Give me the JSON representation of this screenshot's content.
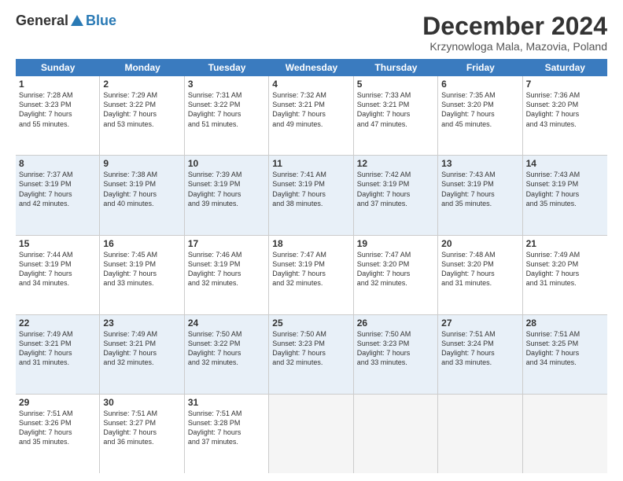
{
  "logo": {
    "general": "General",
    "blue": "Blue"
  },
  "title": "December 2024",
  "subtitle": "Krzynowloga Mala, Mazovia, Poland",
  "days": [
    "Sunday",
    "Monday",
    "Tuesday",
    "Wednesday",
    "Thursday",
    "Friday",
    "Saturday"
  ],
  "rows": [
    [
      {
        "day": "1",
        "sunrise": "7:28 AM",
        "sunset": "3:23 PM",
        "daylight": "7 hours and 55 minutes."
      },
      {
        "day": "2",
        "sunrise": "7:29 AM",
        "sunset": "3:22 PM",
        "daylight": "7 hours and 53 minutes."
      },
      {
        "day": "3",
        "sunrise": "7:31 AM",
        "sunset": "3:22 PM",
        "daylight": "7 hours and 51 minutes."
      },
      {
        "day": "4",
        "sunrise": "7:32 AM",
        "sunset": "3:21 PM",
        "daylight": "7 hours and 49 minutes."
      },
      {
        "day": "5",
        "sunrise": "7:33 AM",
        "sunset": "3:21 PM",
        "daylight": "7 hours and 47 minutes."
      },
      {
        "day": "6",
        "sunrise": "7:35 AM",
        "sunset": "3:20 PM",
        "daylight": "7 hours and 45 minutes."
      },
      {
        "day": "7",
        "sunrise": "7:36 AM",
        "sunset": "3:20 PM",
        "daylight": "7 hours and 43 minutes."
      }
    ],
    [
      {
        "day": "8",
        "sunrise": "7:37 AM",
        "sunset": "3:19 PM",
        "daylight": "7 hours and 42 minutes."
      },
      {
        "day": "9",
        "sunrise": "7:38 AM",
        "sunset": "3:19 PM",
        "daylight": "7 hours and 40 minutes."
      },
      {
        "day": "10",
        "sunrise": "7:39 AM",
        "sunset": "3:19 PM",
        "daylight": "7 hours and 39 minutes."
      },
      {
        "day": "11",
        "sunrise": "7:41 AM",
        "sunset": "3:19 PM",
        "daylight": "7 hours and 38 minutes."
      },
      {
        "day": "12",
        "sunrise": "7:42 AM",
        "sunset": "3:19 PM",
        "daylight": "7 hours and 37 minutes."
      },
      {
        "day": "13",
        "sunrise": "7:43 AM",
        "sunset": "3:19 PM",
        "daylight": "7 hours and 35 minutes."
      },
      {
        "day": "14",
        "sunrise": "7:43 AM",
        "sunset": "3:19 PM",
        "daylight": "7 hours and 35 minutes."
      }
    ],
    [
      {
        "day": "15",
        "sunrise": "7:44 AM",
        "sunset": "3:19 PM",
        "daylight": "7 hours and 34 minutes."
      },
      {
        "day": "16",
        "sunrise": "7:45 AM",
        "sunset": "3:19 PM",
        "daylight": "7 hours and 33 minutes."
      },
      {
        "day": "17",
        "sunrise": "7:46 AM",
        "sunset": "3:19 PM",
        "daylight": "7 hours and 32 minutes."
      },
      {
        "day": "18",
        "sunrise": "7:47 AM",
        "sunset": "3:19 PM",
        "daylight": "7 hours and 32 minutes."
      },
      {
        "day": "19",
        "sunrise": "7:47 AM",
        "sunset": "3:20 PM",
        "daylight": "7 hours and 32 minutes."
      },
      {
        "day": "20",
        "sunrise": "7:48 AM",
        "sunset": "3:20 PM",
        "daylight": "7 hours and 31 minutes."
      },
      {
        "day": "21",
        "sunrise": "7:49 AM",
        "sunset": "3:20 PM",
        "daylight": "7 hours and 31 minutes."
      }
    ],
    [
      {
        "day": "22",
        "sunrise": "7:49 AM",
        "sunset": "3:21 PM",
        "daylight": "7 hours and 31 minutes."
      },
      {
        "day": "23",
        "sunrise": "7:49 AM",
        "sunset": "3:21 PM",
        "daylight": "7 hours and 32 minutes."
      },
      {
        "day": "24",
        "sunrise": "7:50 AM",
        "sunset": "3:22 PM",
        "daylight": "7 hours and 32 minutes."
      },
      {
        "day": "25",
        "sunrise": "7:50 AM",
        "sunset": "3:23 PM",
        "daylight": "7 hours and 32 minutes."
      },
      {
        "day": "26",
        "sunrise": "7:50 AM",
        "sunset": "3:23 PM",
        "daylight": "7 hours and 33 minutes."
      },
      {
        "day": "27",
        "sunrise": "7:51 AM",
        "sunset": "3:24 PM",
        "daylight": "7 hours and 33 minutes."
      },
      {
        "day": "28",
        "sunrise": "7:51 AM",
        "sunset": "3:25 PM",
        "daylight": "7 hours and 34 minutes."
      }
    ],
    [
      {
        "day": "29",
        "sunrise": "7:51 AM",
        "sunset": "3:26 PM",
        "daylight": "7 hours and 35 minutes."
      },
      {
        "day": "30",
        "sunrise": "7:51 AM",
        "sunset": "3:27 PM",
        "daylight": "7 hours and 36 minutes."
      },
      {
        "day": "31",
        "sunrise": "7:51 AM",
        "sunset": "3:28 PM",
        "daylight": "7 hours and 37 minutes."
      },
      null,
      null,
      null,
      null
    ]
  ],
  "labels": {
    "sunrise": "Sunrise: ",
    "sunset": "Sunset: ",
    "daylight": "Daylight: "
  }
}
